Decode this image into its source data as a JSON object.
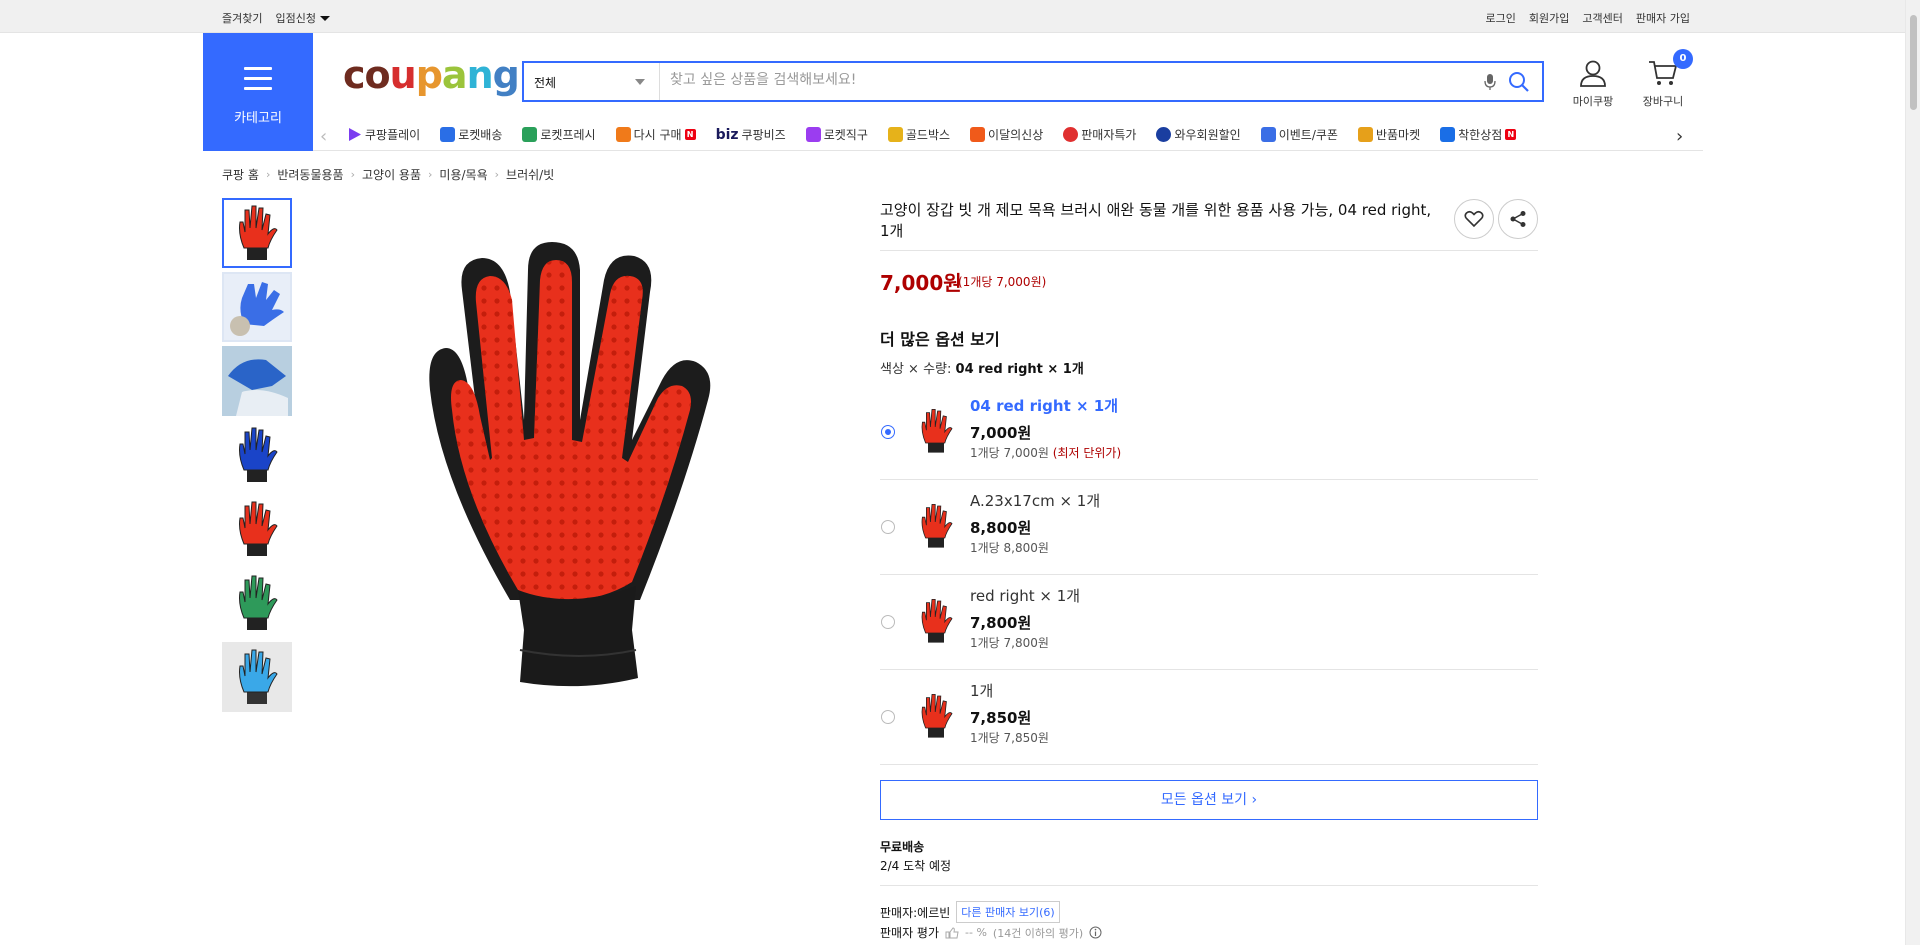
{
  "topbar": {
    "bookmark": "즐겨찾기",
    "apply": "입점신청",
    "login": "로그인",
    "signup": "회원가입",
    "support": "고객센터",
    "seller_signup": "판매자 가입"
  },
  "header": {
    "category_label": "카테고리",
    "logo": [
      "c",
      "o",
      "u",
      "p",
      "a",
      "n",
      "g"
    ],
    "search_category": "전체",
    "search_placeholder": "찾고 싶은 상품을 검색해보세요!",
    "mycoupang_label": "마이쿠팡",
    "cart_label": "장바구니",
    "cart_count": "0"
  },
  "shortcuts": [
    {
      "label": "쿠팡플레이",
      "icon": "play-icon",
      "color": "#7b3df0"
    },
    {
      "label": "로켓배송",
      "icon": "rocket-icon",
      "color": "#2a6ee6"
    },
    {
      "label": "로켓프레시",
      "icon": "rocket-fresh-icon",
      "color": "#2aa05a"
    },
    {
      "label": "다시 구매",
      "icon": "rebuy-icon",
      "color": "#f07a1a",
      "badge": "N"
    },
    {
      "label": "쿠팡비즈",
      "icon": "biz-icon",
      "prefix": "biz"
    },
    {
      "label": "로켓직구",
      "icon": "global-icon",
      "color": "#9b3df0"
    },
    {
      "label": "골드박스",
      "icon": "goldbox-icon",
      "color": "#e6b21a"
    },
    {
      "label": "이달의신상",
      "icon": "new-icon",
      "color": "#f05a1a"
    },
    {
      "label": "판매자특가",
      "icon": "discount-icon",
      "color": "#e03030"
    },
    {
      "label": "와우회원할인",
      "icon": "wow-icon",
      "color": "#1a3ea0"
    },
    {
      "label": "이벤트/쿠폰",
      "icon": "coupon-icon",
      "color": "#3a6ee6"
    },
    {
      "label": "반품마켓",
      "icon": "return-market-icon",
      "color": "#e6a01a"
    },
    {
      "label": "착한상점",
      "icon": "good-store-icon",
      "color": "#1a6ee6",
      "badge": "N"
    }
  ],
  "breadcrumb": [
    "쿠팡 홈",
    "반려동물용품",
    "고양이 용품",
    "미용/목욕",
    "브러쉬/빗"
  ],
  "product": {
    "title": "고양이 장갑 빗 개 제모 목욕 브러시 애완 동물 개를 위한 용품 사용 가능, 04 red right, 1개",
    "price": "7,000원",
    "unit_price": "(1개당 7,000원)"
  },
  "options": {
    "heading": "더 많은 옵션 보기",
    "selected_label": "색상 × 수량:",
    "selected_value": "04 red right × 1개",
    "items": [
      {
        "name": "04 red right × 1개",
        "price": "7,000원",
        "unit": "1개당 7,000원",
        "tag": "(최저 단위가)",
        "selected": true
      },
      {
        "name": "A.23x17cm × 1개",
        "price": "8,800원",
        "unit": "1개당 8,800원",
        "tag": "",
        "selected": false
      },
      {
        "name": "red right × 1개",
        "price": "7,800원",
        "unit": "1개당 7,800원",
        "tag": "",
        "selected": false
      },
      {
        "name": "1개",
        "price": "7,850원",
        "unit": "1개당 7,850원",
        "tag": "",
        "selected": false
      }
    ],
    "all_button": "모든 옵션 보기 ›"
  },
  "shipping": {
    "type": "무료배송",
    "arrival": "2/4 도착 예정"
  },
  "seller": {
    "label": "판매자:",
    "name": "에르빈",
    "other_sellers": "다른 판매자 보기(6)",
    "rating_label": "판매자 평가",
    "rating_value": "-- %",
    "rating_note": "(14건 이하의 평가)"
  },
  "colors": {
    "accent": "#346aff",
    "price_red": "#ae0000",
    "glove_red": "#e8301c"
  }
}
